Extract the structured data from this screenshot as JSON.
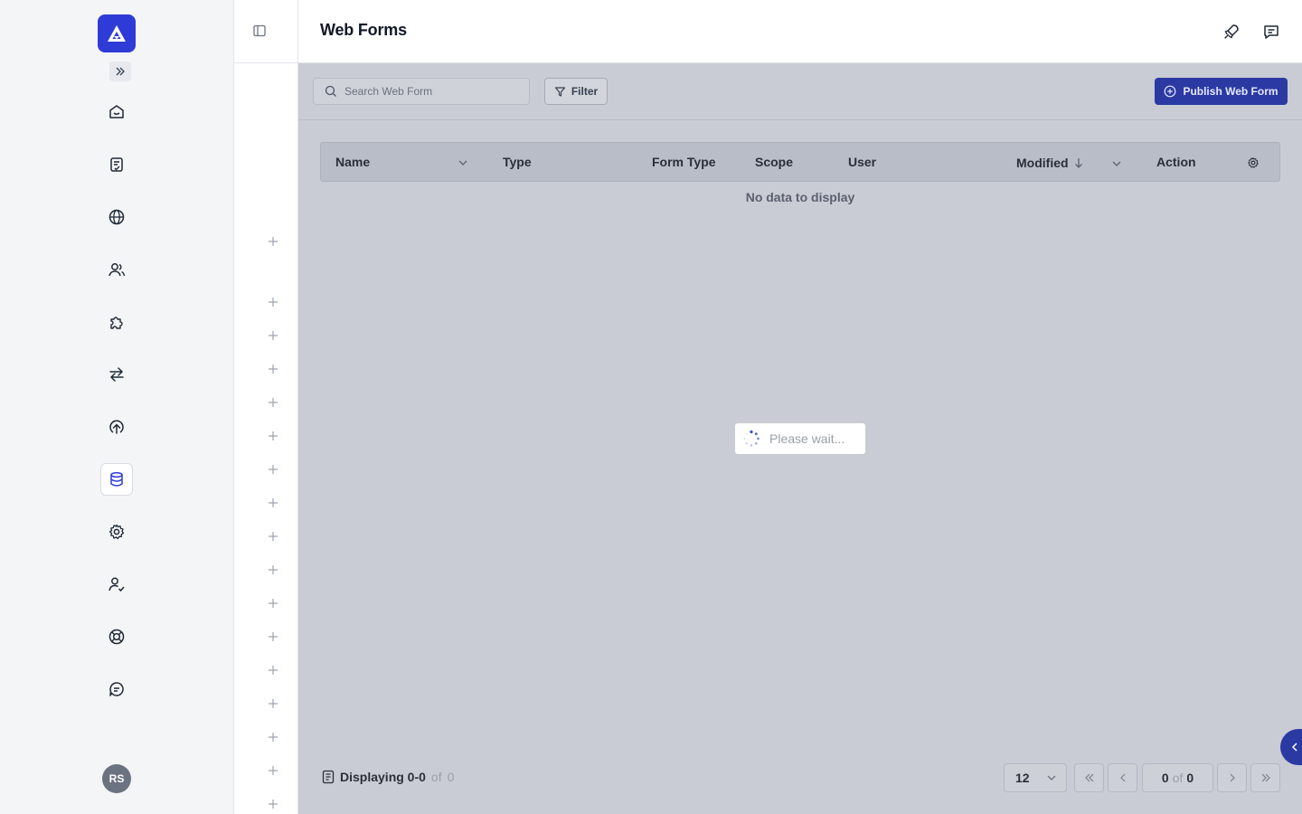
{
  "header": {
    "title": "Web Forms"
  },
  "rail": {
    "avatar_initials": "RS",
    "items": [
      "home-icon",
      "document-check-icon",
      "globe-icon",
      "users-icon",
      "puzzle-icon",
      "transfer-icon",
      "upload-circle-icon",
      "database-icon",
      "gear-icon",
      "user-check-icon",
      "lifebuoy-icon",
      "chat-icon"
    ],
    "active": "database-icon"
  },
  "toolbar": {
    "search_placeholder": "Search Web Form",
    "filter_label": "Filter",
    "publish_label": "Publish Web Form"
  },
  "table": {
    "columns": [
      "Name",
      "Type",
      "Form Type",
      "Scope",
      "User",
      "Modified",
      "Action"
    ],
    "empty_text": "No data to display"
  },
  "loading": {
    "text": "Please wait..."
  },
  "footer": {
    "displaying_label": "Displaying 0-0",
    "of_label": "of",
    "total": "0",
    "page_size": "12",
    "current_page": "0",
    "page_of": "of",
    "total_pages": "0"
  },
  "colors": {
    "accent": "#2f3bd6",
    "overlay": "#c9ccd4"
  }
}
